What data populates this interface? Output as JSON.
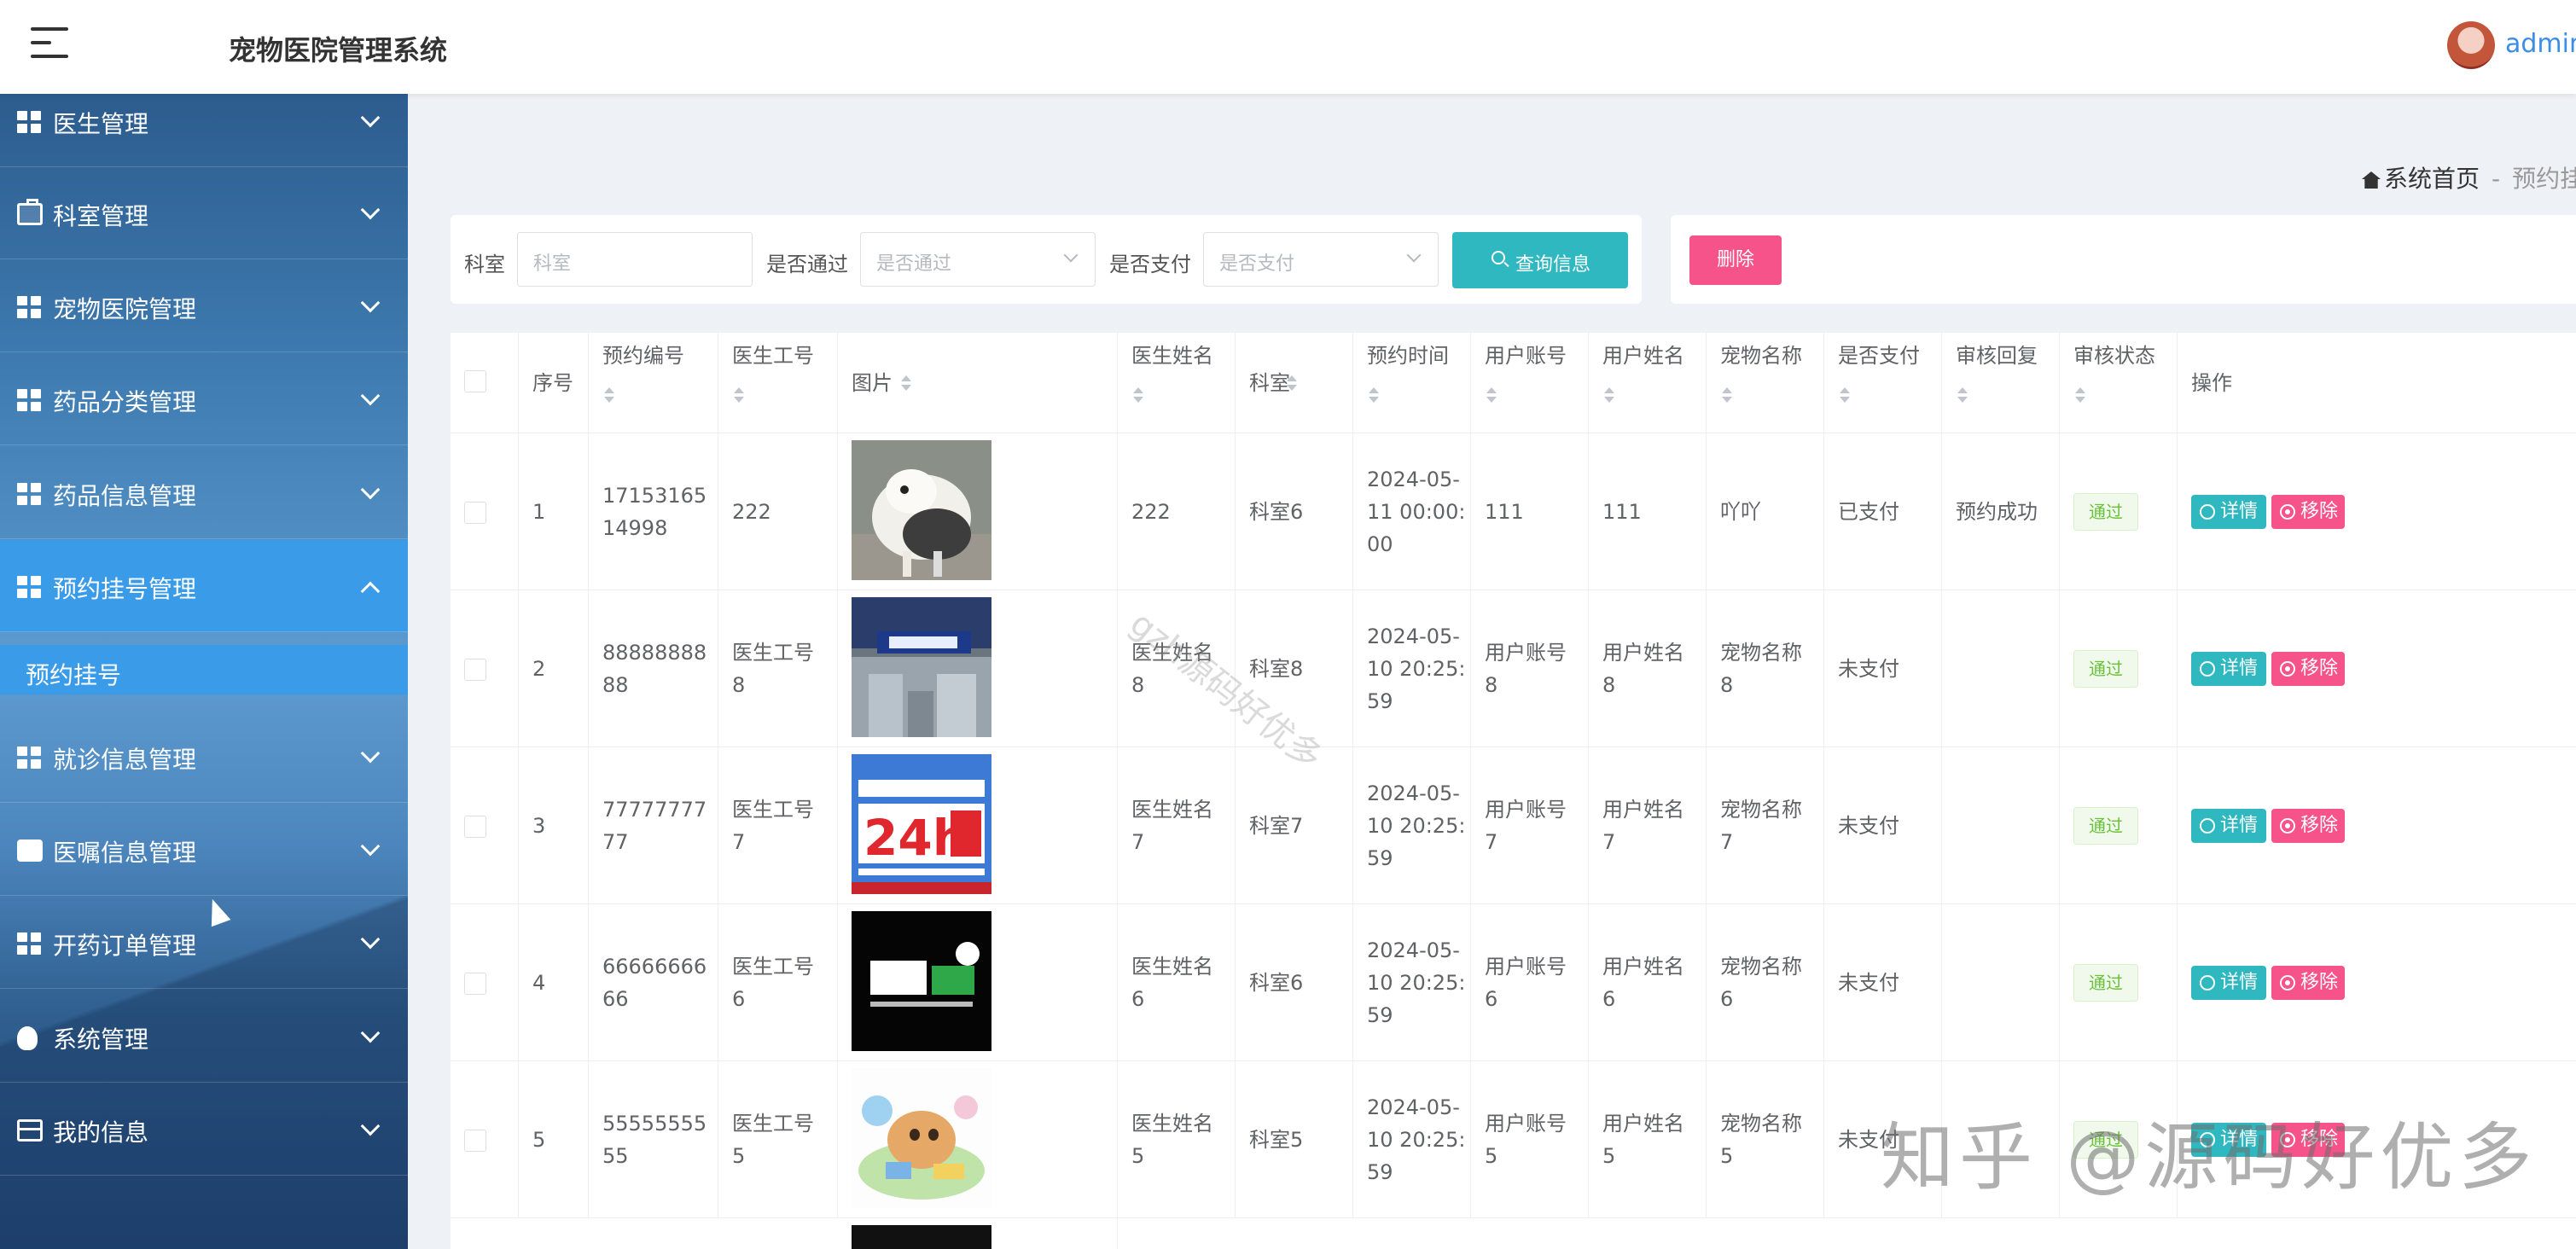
{
  "header": {
    "title": "宠物医院管理系统",
    "user": "admin"
  },
  "sidebar": {
    "items": [
      {
        "label": "医生管理",
        "icon": "grid-icon"
      },
      {
        "label": "科室管理",
        "icon": "briefcase-icon"
      },
      {
        "label": "宠物医院管理",
        "icon": "grid-icon"
      },
      {
        "label": "药品分类管理",
        "icon": "grid-icon"
      },
      {
        "label": "药品信息管理",
        "icon": "grid-icon"
      },
      {
        "label": "预约挂号管理",
        "icon": "grid-icon",
        "expanded": true
      },
      {
        "label": "就诊信息管理",
        "icon": "grid-icon"
      },
      {
        "label": "医嘱信息管理",
        "icon": "inbox-icon"
      },
      {
        "label": "开药订单管理",
        "icon": "grid-icon"
      },
      {
        "label": "系统管理",
        "icon": "bulb-icon"
      },
      {
        "label": "我的信息",
        "icon": "card-icon"
      }
    ],
    "sub_item": "预约挂号"
  },
  "breadcrumb": {
    "home": "系统首页",
    "separator": "-",
    "current": "预约挂"
  },
  "search": {
    "dept_label": "科室",
    "dept_placeholder": "科室",
    "pass_label": "是否通过",
    "pass_placeholder": "是否通过",
    "paid_label": "是否支付",
    "paid_placeholder": "是否支付",
    "query_button": "查询信息"
  },
  "actions": {
    "delete_button": "删除"
  },
  "table": {
    "headers": [
      "序号",
      "预约编号",
      "医生工号",
      "图片",
      "医生姓名",
      "科室",
      "预约时间",
      "用户账号",
      "用户姓名",
      "宠物名称",
      "是否支付",
      "审核回复",
      "审核状态",
      "操作"
    ],
    "rows": [
      {
        "no": "1",
        "code": "17153165\n14998",
        "doc_id": "222",
        "image": "sheepdog-photo",
        "doc_name": "222",
        "dept": "科室6",
        "time": "2024-05-\n11 00:00:\n00",
        "account": "111",
        "user_name": "111",
        "pet": "吖吖",
        "paid": "已支付",
        "reply": "预约成功",
        "status": "通过"
      },
      {
        "no": "2",
        "code": "88888888\n88",
        "doc_id": "医生工号\n8",
        "image": "hospital-photo",
        "doc_name": "医生姓名\n8",
        "dept": "科室8",
        "time": "2024-05-\n10 20:25:\n59",
        "account": "用户账号\n8",
        "user_name": "用户姓名\n8",
        "pet": "宠物名称\n8",
        "paid": "未支付",
        "reply": "",
        "status": "通过"
      },
      {
        "no": "3",
        "code": "77777777\n77",
        "doc_id": "医生工号\n7",
        "image": "24h-poster",
        "doc_name": "医生姓名\n7",
        "dept": "科室7",
        "time": "2024-05-\n10 20:25:\n59",
        "account": "用户账号\n7",
        "user_name": "用户姓名\n7",
        "pet": "宠物名称\n7",
        "paid": "未支付",
        "reply": "",
        "status": "通过"
      },
      {
        "no": "4",
        "code": "66666666\n66",
        "doc_id": "医生工号\n6",
        "image": "pet-hospital-logo",
        "doc_name": "医生姓名\n6",
        "dept": "科室6",
        "time": "2024-05-\n10 20:25:\n59",
        "account": "用户账号\n6",
        "user_name": "用户姓名\n6",
        "pet": "宠物名称\n6",
        "paid": "未支付",
        "reply": "",
        "status": "通过"
      },
      {
        "no": "5",
        "code": "55555555\n55",
        "doc_id": "医生工号\n5",
        "image": "cartoon-dog",
        "doc_name": "医生姓名\n5",
        "dept": "科室5",
        "time": "2024-05-\n10 20:25:\n59",
        "account": "用户账号\n5",
        "user_name": "用户姓名\n5",
        "pet": "宠物名称\n5",
        "paid": "未支付",
        "reply": "",
        "status": "通过"
      }
    ],
    "detail_button": "详情",
    "remove_button": "移除"
  },
  "watermarks": {
    "diagonal": "gzh源码好优多",
    "corner": "知乎 @源码好优多"
  },
  "colors": {
    "sidebar_active": "#3a9be8",
    "teal": "#2fb8c0",
    "pink": "#f6538a",
    "pass_green": "#67c23a"
  }
}
